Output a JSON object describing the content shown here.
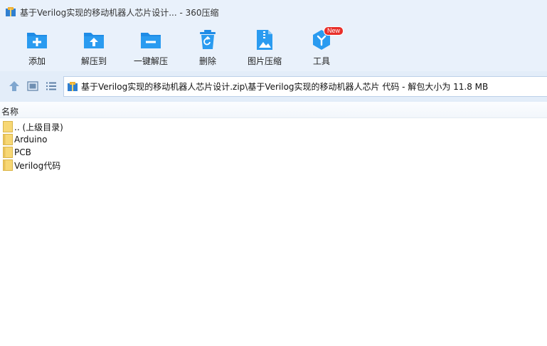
{
  "window": {
    "title": "基于Verilog实现的移动机器人芯片设计... - 360压缩"
  },
  "toolbar": {
    "buttons": [
      {
        "label": "添加",
        "icon": "add-icon"
      },
      {
        "label": "解压到",
        "icon": "extract-to-icon"
      },
      {
        "label": "一键解压",
        "icon": "one-click-extract-icon"
      },
      {
        "label": "删除",
        "icon": "recycle-bin-icon"
      },
      {
        "label": "图片压缩",
        "icon": "image-compress-icon"
      },
      {
        "label": "工具",
        "icon": "tools-icon",
        "badge": "New"
      }
    ]
  },
  "address": {
    "path": "基于Verilog实现的移动机器人芯片设计.zip\\基于Verilog实现的移动机器人芯片 代码 - 解包大小为 11.8 MB"
  },
  "list": {
    "column_name": "名称",
    "items": [
      {
        "name": ".. (上级目录)"
      },
      {
        "name": "Arduino"
      },
      {
        "name": "PCB"
      },
      {
        "name": "Verilog代码"
      }
    ]
  },
  "colors": {
    "accent": "#1f8ce6",
    "chrome": "#e9f1fb",
    "badge": "#e8302b",
    "folder": "#f7d774"
  }
}
